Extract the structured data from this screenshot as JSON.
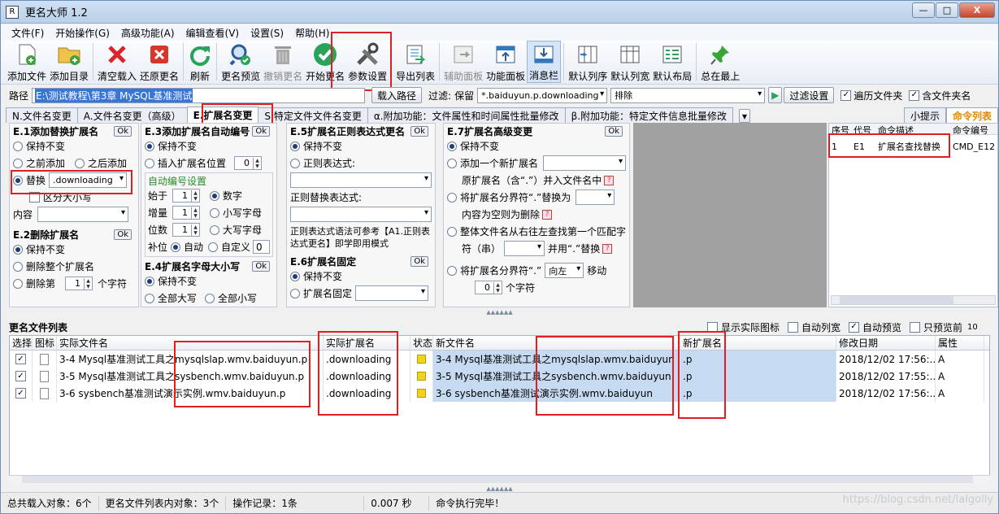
{
  "window": {
    "title": "更名大师 1.2",
    "icon": "R",
    "min": "—",
    "max": "□",
    "close": "X"
  },
  "menu": [
    "文件(F)",
    "开始操作(G)",
    "高级功能(A)",
    "编辑查看(V)",
    "设置(S)",
    "帮助(H)"
  ],
  "toolbar": [
    {
      "label": "添加文件",
      "icon": "add-file-icon"
    },
    {
      "label": "添加目录",
      "icon": "add-folder-icon"
    },
    {
      "label": "清空载入",
      "icon": "clear-icon"
    },
    {
      "label": "还原更名",
      "icon": "undo-rename-icon"
    },
    {
      "label": "刷新",
      "icon": "refresh-icon"
    },
    {
      "label": "更名预览",
      "icon": "preview-icon"
    },
    {
      "label": "撤销更名",
      "icon": "trash-icon"
    },
    {
      "label": "开始更名",
      "icon": "check-icon"
    },
    {
      "label": "参数设置",
      "icon": "tools-icon"
    },
    {
      "label": "导出列表",
      "icon": "export-icon"
    },
    {
      "label": "辅助面板",
      "icon": "aux-panel-icon"
    },
    {
      "label": "功能面板",
      "icon": "func-panel-icon"
    },
    {
      "label": "消息栏",
      "icon": "message-bar-icon"
    },
    {
      "label": "默认列序",
      "icon": "col-order-icon"
    },
    {
      "label": "默认列宽",
      "icon": "col-width-icon"
    },
    {
      "label": "默认布局",
      "icon": "layout-icon"
    },
    {
      "label": "总在最上",
      "icon": "pin-icon"
    }
  ],
  "pathbar": {
    "path_label": "路径",
    "path_value": "E:\\测试教程\\第3章 MySQL基准测试",
    "load_button": "载入路径",
    "filter_label": "过滤:",
    "filter_mode": "保留",
    "filter_value": "*.baiduyun.p.downloading",
    "exclude": "排除",
    "filter_settings": "过滤设置",
    "traverse_folders": "遍历文件夹",
    "include_folder_name": "含文件夹名"
  },
  "tabs": [
    "N.文件名变更",
    "A.文件名变更（高级）",
    "E.扩展名变更",
    "S.特定文件文件名变更",
    "α.附加功能：文件属性和时间属性批量修改",
    "β.附加功能：特定文件信息批量修改"
  ],
  "right_tabs": [
    "小提示",
    "命令列表"
  ],
  "e1": {
    "title": "E.1添加替换扩展名",
    "ok": "Ok",
    "keep": "保持不变",
    "before": "之前添加",
    "after": "之后添加",
    "replace": "替换",
    "replace_value": ".downloading",
    "case": "区分大小写",
    "content": "内容"
  },
  "e2": {
    "title": "E.2删除扩展名",
    "ok": "Ok",
    "keep": "保持不变",
    "delete_all": "删除整个扩展名",
    "delete_nth": "删除第",
    "nth_value": "1",
    "chars": "个字符"
  },
  "e3": {
    "title": "E.3添加扩展名自动编号",
    "ok": "Ok",
    "keep": "保持不变",
    "insert_pos": "插入扩展名位置",
    "pos_value": "0",
    "auto_title": "自动编号设置",
    "start": "始于",
    "start_v": "1",
    "step": "增量",
    "step_v": "1",
    "digits": "位数",
    "digits_v": "1",
    "num": "数字",
    "lower": "小写字母",
    "upper": "大写字母",
    "pad": "补位",
    "auto": "自动",
    "custom": "自定义",
    "custom_v": "0"
  },
  "e4": {
    "title": "E.4扩展名字母大小写",
    "ok": "Ok",
    "keep": "保持不变",
    "all_upper": "全部大写",
    "all_lower": "全部小写"
  },
  "e5": {
    "title": "E.5扩展名正则表达式更名",
    "ok": "Ok",
    "keep": "保持不变",
    "regex": "正则表达式:",
    "replace_regex": "正则替换表达式:",
    "hint": "正则表达式语法可参考【A1.正则表达式更名】即学即用模式"
  },
  "e6": {
    "title": "E.6扩展名固定",
    "ok": "Ok",
    "keep": "保持不变",
    "fixed": "扩展名固定"
  },
  "e7": {
    "title": "E.7扩展名高级变更",
    "ok": "Ok",
    "keep": "保持不变",
    "add_new": "添加一个新扩展名",
    "merge": "原扩展名（含“.”）并入文件名中",
    "sep_replace": "将扩展名分界符“.”替换为",
    "empty_del": "内容为空则为删除",
    "search": "整体文件名从右往左查找第一个匹配字",
    "search2": "符（串）",
    "search3": "并用“.”替换",
    "move": "将扩展名分界符“.”",
    "dir": "向左",
    "move2": "移动",
    "move_n": "0",
    "chars": "个字符"
  },
  "cmd_list": {
    "headers": [
      "序号",
      "代号",
      "命令描述",
      "命令编号"
    ],
    "rows": [
      [
        "1",
        "E1",
        "扩展名查找替换",
        "CMD_E12"
      ]
    ]
  },
  "file_list": {
    "title": "更名文件列表",
    "opts": [
      "显示实际图标",
      "自动列宽",
      "自动预览",
      "只预览前"
    ],
    "preview_n": "10",
    "headers": [
      "选择",
      "图标",
      "实际文件名",
      "实际扩展名",
      "状态",
      "新文件名",
      "新扩展名",
      "修改日期",
      "属性"
    ],
    "rows": [
      {
        "name": "3-4 Mysql基准测试工具之mysqlslap.wmv.baiduyun.p",
        "ext": ".downloading",
        "new_name": "3-4 Mysql基准测试工具之mysqlslap.wmv.baiduyun",
        "new_ext": ".p",
        "date": "2018/12/02 17:56:...",
        "attr": "A"
      },
      {
        "name": "3-5 Mysql基准测试工具之sysbench.wmv.baiduyun.p",
        "ext": ".downloading",
        "new_name": "3-5 Mysql基准测试工具之sysbench.wmv.baiduyun",
        "new_ext": ".p",
        "date": "2018/12/02 17:55:...",
        "attr": "A"
      },
      {
        "name": "3-6 sysbench基准测试演示实例.wmv.baiduyun.p",
        "ext": ".downloading",
        "new_name": "3-6 sysbench基准测试演示实例.wmv.baiduyun",
        "new_ext": ".p",
        "date": "2018/12/02 17:56:...",
        "attr": "A"
      }
    ]
  },
  "status": {
    "loaded": "总共载入对象：6个",
    "in_list": "更名文件列表内对象：3个",
    "ops": "操作记录：1条",
    "time": "0.007 秒",
    "msg": "命令执行完毕！"
  },
  "watermark": "https://blog.csdn.net/lalgolly",
  "colors": {
    "accent": "#e02020",
    "selected_row": "#c6dbf2",
    "gray_panel": "#a0a0a0"
  }
}
